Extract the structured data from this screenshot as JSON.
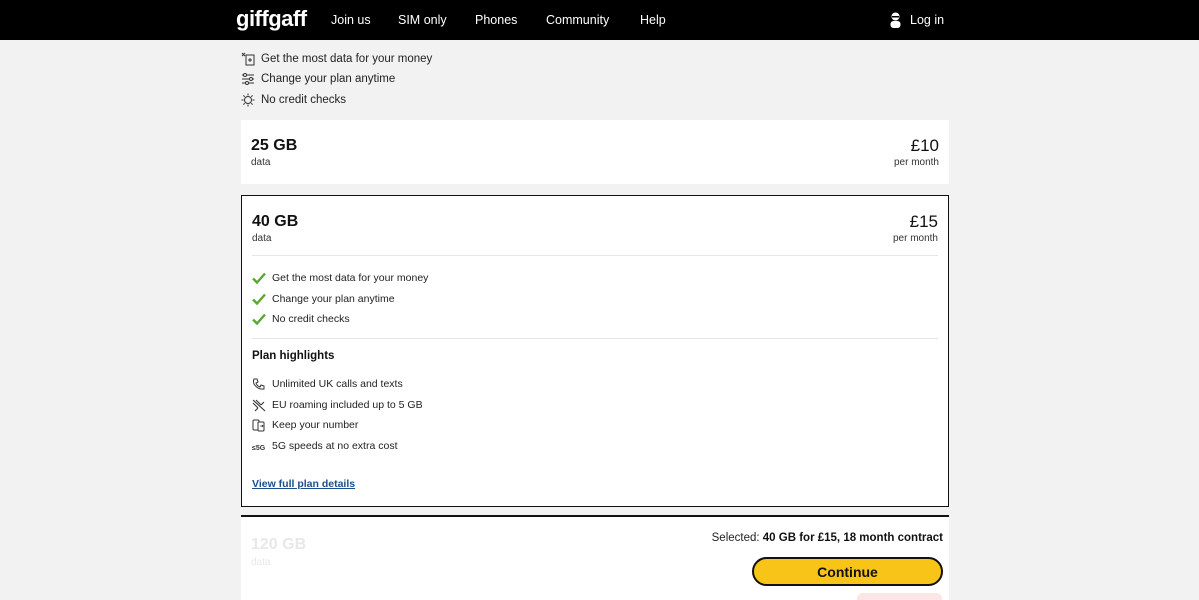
{
  "header": {
    "logo": "giffgaff",
    "nav": [
      "Join us",
      "SIM only",
      "Phones",
      "Community",
      "Help"
    ],
    "login_label": "Log in"
  },
  "benefits": [
    {
      "icon": "data-money-icon",
      "label": "Get the most data for your money"
    },
    {
      "icon": "sliders-icon",
      "label": "Change your plan anytime"
    },
    {
      "icon": "sun-badge-icon",
      "label": "No credit checks"
    }
  ],
  "plans": [
    {
      "data": "25 GB",
      "data_label": "data",
      "price": "£10",
      "price_label": "per month"
    },
    {
      "data": "40 GB",
      "data_label": "data",
      "price": "£15",
      "price_label": "per month",
      "checks": [
        "Get the most data for your money",
        "Change your plan anytime",
        "No credit checks"
      ],
      "highlights_title": "Plan highlights",
      "highlights": [
        {
          "icon": "phone-icon",
          "label": "Unlimited UK calls and texts"
        },
        {
          "icon": "plane-icon",
          "label": "EU roaming included up to 5 GB"
        },
        {
          "icon": "phone-transfer-icon",
          "label": "Keep your number"
        },
        {
          "icon": "5g-icon",
          "label": "5G speeds at no extra cost"
        }
      ],
      "details_link": "View full plan details"
    },
    {
      "data": "120 GB",
      "data_label": "data"
    }
  ],
  "selection": {
    "prefix": "Selected:",
    "value": "40 GB for £15, 18 month contract",
    "continue_label": "Continue"
  },
  "colors": {
    "header_bg": "#000000",
    "page_bg": "#f2f2f2",
    "accent_yellow": "#f8c417",
    "check_green": "#5aa832",
    "link_blue": "#1c4d8c"
  }
}
